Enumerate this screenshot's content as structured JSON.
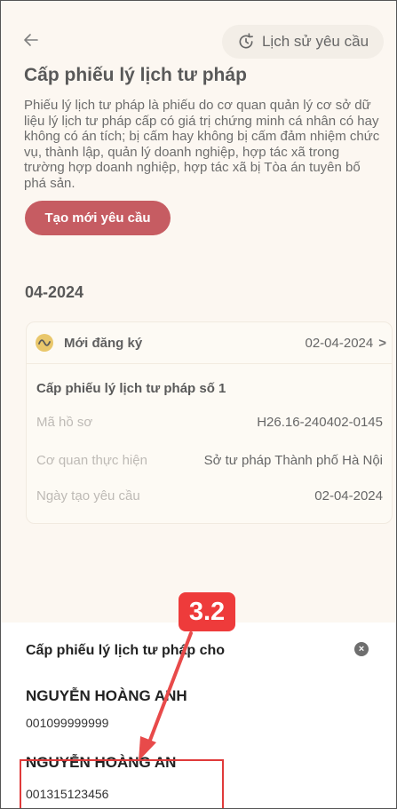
{
  "header": {
    "history_label": "Lịch sử yêu cầu",
    "title": "Cấp phiếu lý lịch tư pháp",
    "description": "Phiếu lý lịch tư pháp là phiếu do cơ quan quản lý cơ sở dữ liệu lý lịch tư pháp cấp có giá trị chứng minh cá nhân có hay không có án tích; bị cấm hay không bị cấm đảm nhiệm chức vụ, thành lập, quản lý doanh nghiệp, hợp tác xã trong trường hợp doanh nghiệp, hợp tác xã bị Tòa án tuyên bố phá sản.",
    "create_label": "Tạo mới yêu cầu"
  },
  "requests": {
    "month": "04-2024",
    "card": {
      "status": "Mới đăng ký",
      "date": "02-04-2024",
      "chevron": ">",
      "name": "Cấp phiếu lý lịch tư pháp số 1",
      "rows": [
        {
          "key": "Mã hồ sơ",
          "value": "H26.16-240402-0145"
        },
        {
          "key": "Cơ quan thực hiện",
          "value": "Sở tư pháp Thành phố Hà Nội"
        },
        {
          "key": "Ngày tạo yêu cầu",
          "value": "02-04-2024"
        }
      ]
    }
  },
  "sheet": {
    "title": "Cấp phiếu lý lịch tư pháp cho",
    "close": "×",
    "people": [
      {
        "name": "NGUYỄN HOÀNG ANH",
        "id": "001099999999"
      },
      {
        "name": "NGUYỄN HOÀNG AN",
        "id": "001315123456"
      }
    ]
  },
  "annotation": {
    "step": "3.2"
  },
  "colors": {
    "accent": "#b3262e",
    "status": "#e2b53a",
    "annotation": "#e03a3a"
  },
  "icons": [
    "back-arrow-icon",
    "history-icon",
    "status-wave-icon",
    "chevron-right-icon",
    "close-icon"
  ]
}
